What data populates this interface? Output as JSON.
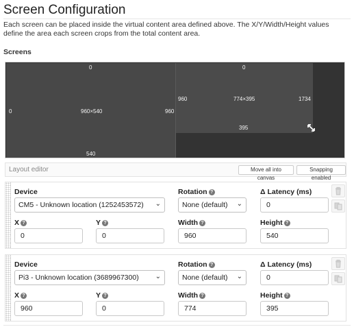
{
  "header": {
    "title": "Screen Configuration",
    "description": "Each screen can be placed inside the virtual content area defined above. The X/Y/Width/Height values define the area each screen crops from the total content area.",
    "screens_label": "Screens"
  },
  "canvas": {
    "screens": [
      {
        "top": "0",
        "left": "0",
        "size": "960×540",
        "right": "960",
        "bottom": "540"
      },
      {
        "top": "0",
        "left": "960",
        "size": "774×395",
        "right": "1734",
        "bottom": "395"
      }
    ]
  },
  "layout_editor": {
    "title": "Layout editor",
    "move_all_label": "Move all into canvas",
    "snapping_label": "Snapping enabled"
  },
  "field_labels": {
    "device": "Device",
    "rotation": "Rotation",
    "latency": "Δ Latency (ms)",
    "x": "X",
    "y": "Y",
    "width": "Width",
    "height": "Height"
  },
  "cards": [
    {
      "device": "CM5 - Unknown location (1252453572)",
      "rotation": "None (default)",
      "latency": "0",
      "x": "0",
      "y": "0",
      "width": "960",
      "height": "540"
    },
    {
      "device": "Pi3 - Unknown location (3689967300)",
      "rotation": "None (default)",
      "latency": "0",
      "x": "960",
      "y": "0",
      "width": "774",
      "height": "395"
    }
  ],
  "icons": {
    "help": "question-circle-icon",
    "delete": "trash-icon",
    "duplicate": "copy-icon",
    "resize": "resize-diagonal-icon"
  }
}
